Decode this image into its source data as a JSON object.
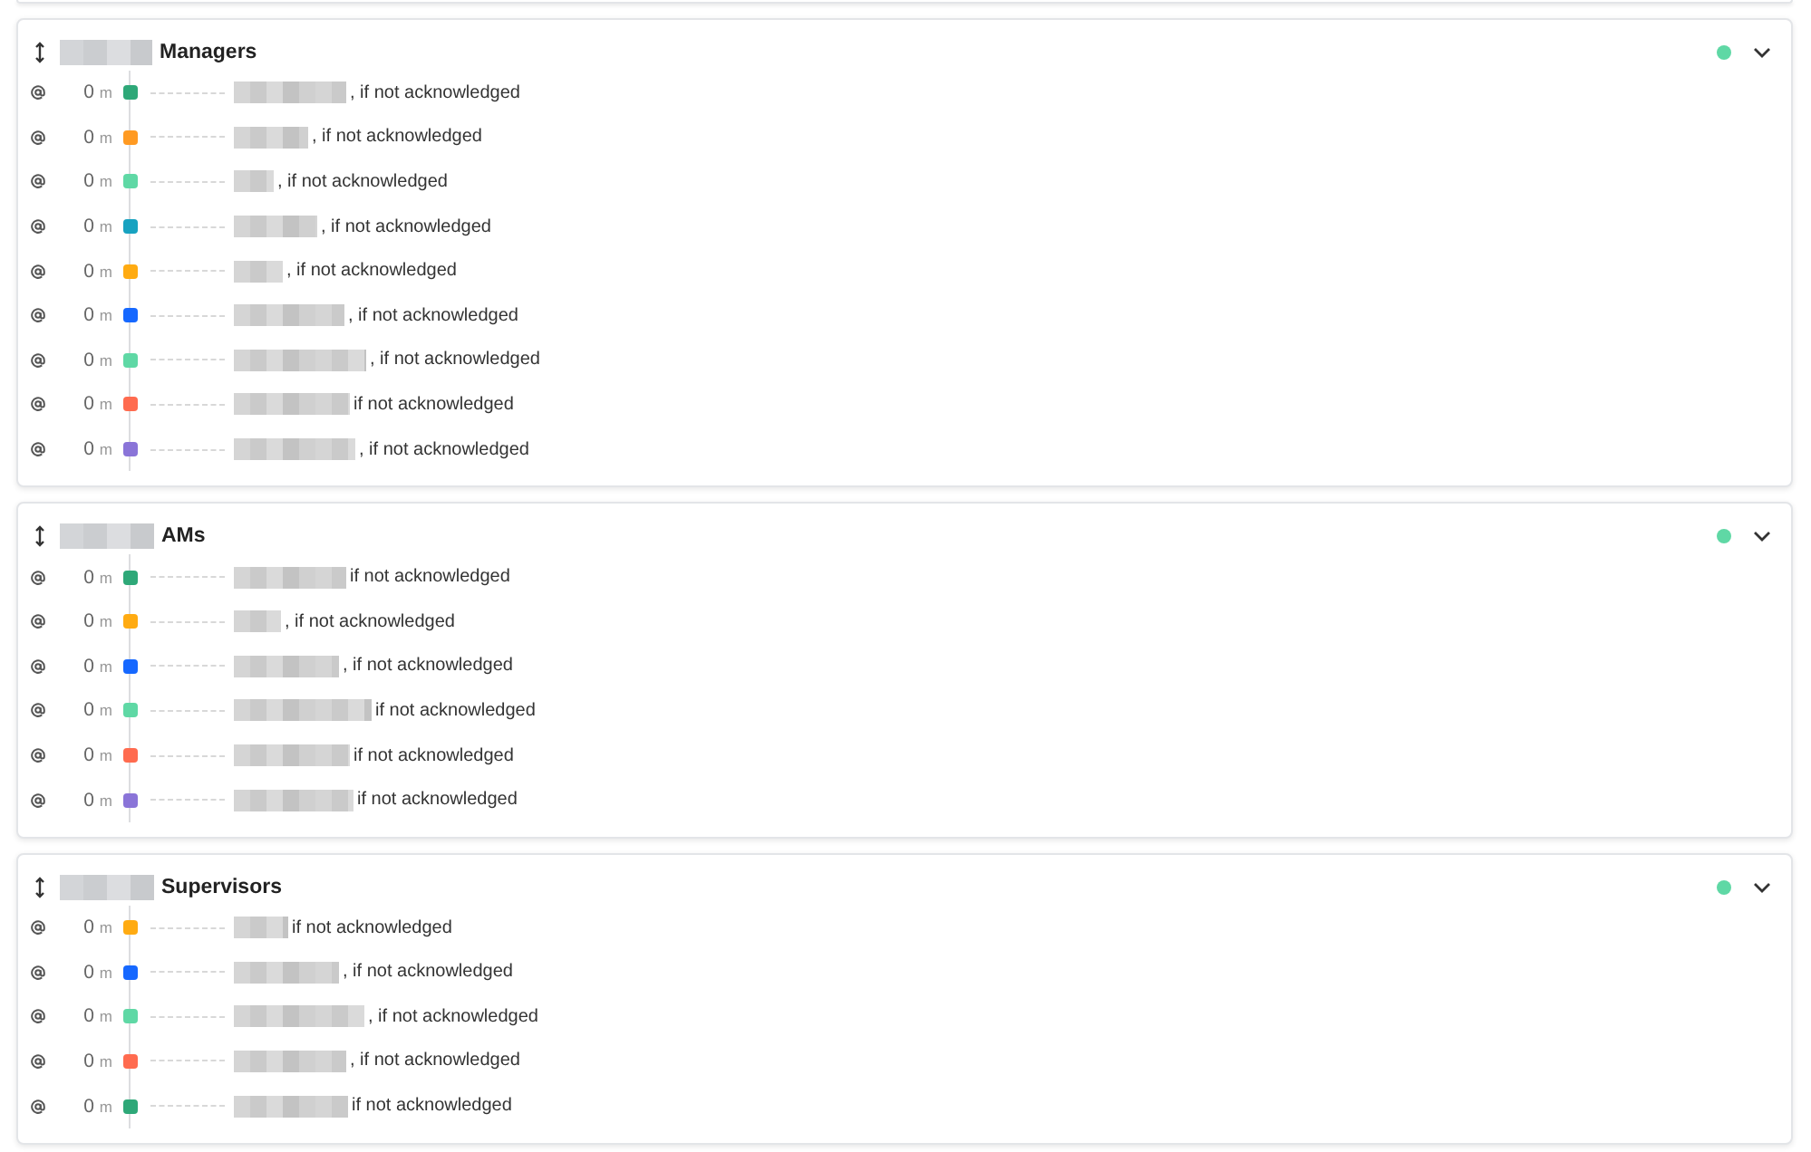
{
  "cards": [
    {
      "title": "Managers",
      "active": true,
      "rows": [
        {
          "delay": "0",
          "unit": "m",
          "color": "#2ea878",
          "text": ", if not acknowledged"
        },
        {
          "delay": "0",
          "unit": "m",
          "color": "#ff9a22",
          "text": ", if not acknowledged"
        },
        {
          "delay": "0",
          "unit": "m",
          "color": "#5fd8a5",
          "text": ", if not acknowledged"
        },
        {
          "delay": "0",
          "unit": "m",
          "color": "#17a2c0",
          "text": ", if not acknowledged"
        },
        {
          "delay": "0",
          "unit": "m",
          "color": "#ffab12",
          "text": ", if not acknowledged"
        },
        {
          "delay": "0",
          "unit": "m",
          "color": "#1668ff",
          "text": ", if not acknowledged"
        },
        {
          "delay": "0",
          "unit": "m",
          "color": "#5fd8a5",
          "text": ", if not acknowledged"
        },
        {
          "delay": "0",
          "unit": "m",
          "color": "#ff6b4f",
          "text": "if not acknowledged"
        },
        {
          "delay": "0",
          "unit": "m",
          "color": "#8a74d8",
          "text": ", if not acknowledged"
        }
      ]
    },
    {
      "title": "AMs",
      "active": true,
      "rows": [
        {
          "delay": "0",
          "unit": "m",
          "color": "#2ea878",
          "text": "if not acknowledged"
        },
        {
          "delay": "0",
          "unit": "m",
          "color": "#ffab12",
          "text": ", if not acknowledged"
        },
        {
          "delay": "0",
          "unit": "m",
          "color": "#1668ff",
          "text": ", if not acknowledged"
        },
        {
          "delay": "0",
          "unit": "m",
          "color": "#5fd8a5",
          "text": "if not acknowledged"
        },
        {
          "delay": "0",
          "unit": "m",
          "color": "#ff6b4f",
          "text": "if not acknowledged"
        },
        {
          "delay": "0",
          "unit": "m",
          "color": "#8a74d8",
          "text": "if not acknowledged"
        }
      ]
    },
    {
      "title": "Supervisors",
      "active": true,
      "rows": [
        {
          "delay": "0",
          "unit": "m",
          "color": "#ffab12",
          "text": "if not acknowledged"
        },
        {
          "delay": "0",
          "unit": "m",
          "color": "#1668ff",
          "text": ", if not acknowledged"
        },
        {
          "delay": "0",
          "unit": "m",
          "color": "#5fd8a5",
          "text": ", if not acknowledged"
        },
        {
          "delay": "0",
          "unit": "m",
          "color": "#ff6b4f",
          "text": ", if not acknowledged"
        },
        {
          "delay": "0",
          "unit": "m",
          "color": "#2ea878",
          "text": "if not acknowledged"
        }
      ]
    }
  ]
}
